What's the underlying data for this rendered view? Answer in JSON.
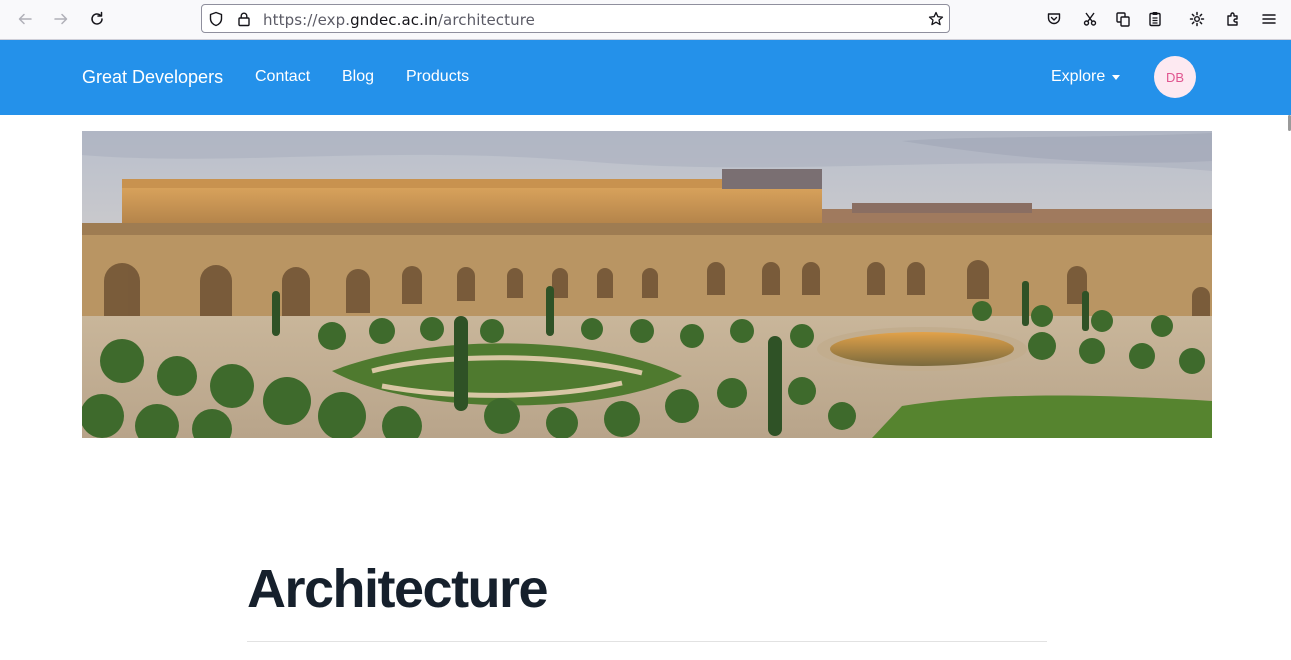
{
  "browser": {
    "url_prefix": "https://exp.",
    "url_domain": "gndec.ac.in",
    "url_path": "/architecture",
    "icons": [
      "back-icon",
      "forward-icon",
      "reload-icon",
      "shield-icon",
      "lock-icon",
      "bookmark-star-icon",
      "pocket-icon",
      "cut-icon",
      "copy-icon",
      "clipboard-icon",
      "settings-gear-icon",
      "extensions-icon",
      "menu-icon"
    ]
  },
  "navbar": {
    "brand": "Great Developers",
    "links": [
      "Contact",
      "Blog",
      "Products"
    ],
    "explore_label": "Explore",
    "avatar_initials": "DB",
    "background_color": "#2491ea"
  },
  "page": {
    "title": "Architecture"
  }
}
